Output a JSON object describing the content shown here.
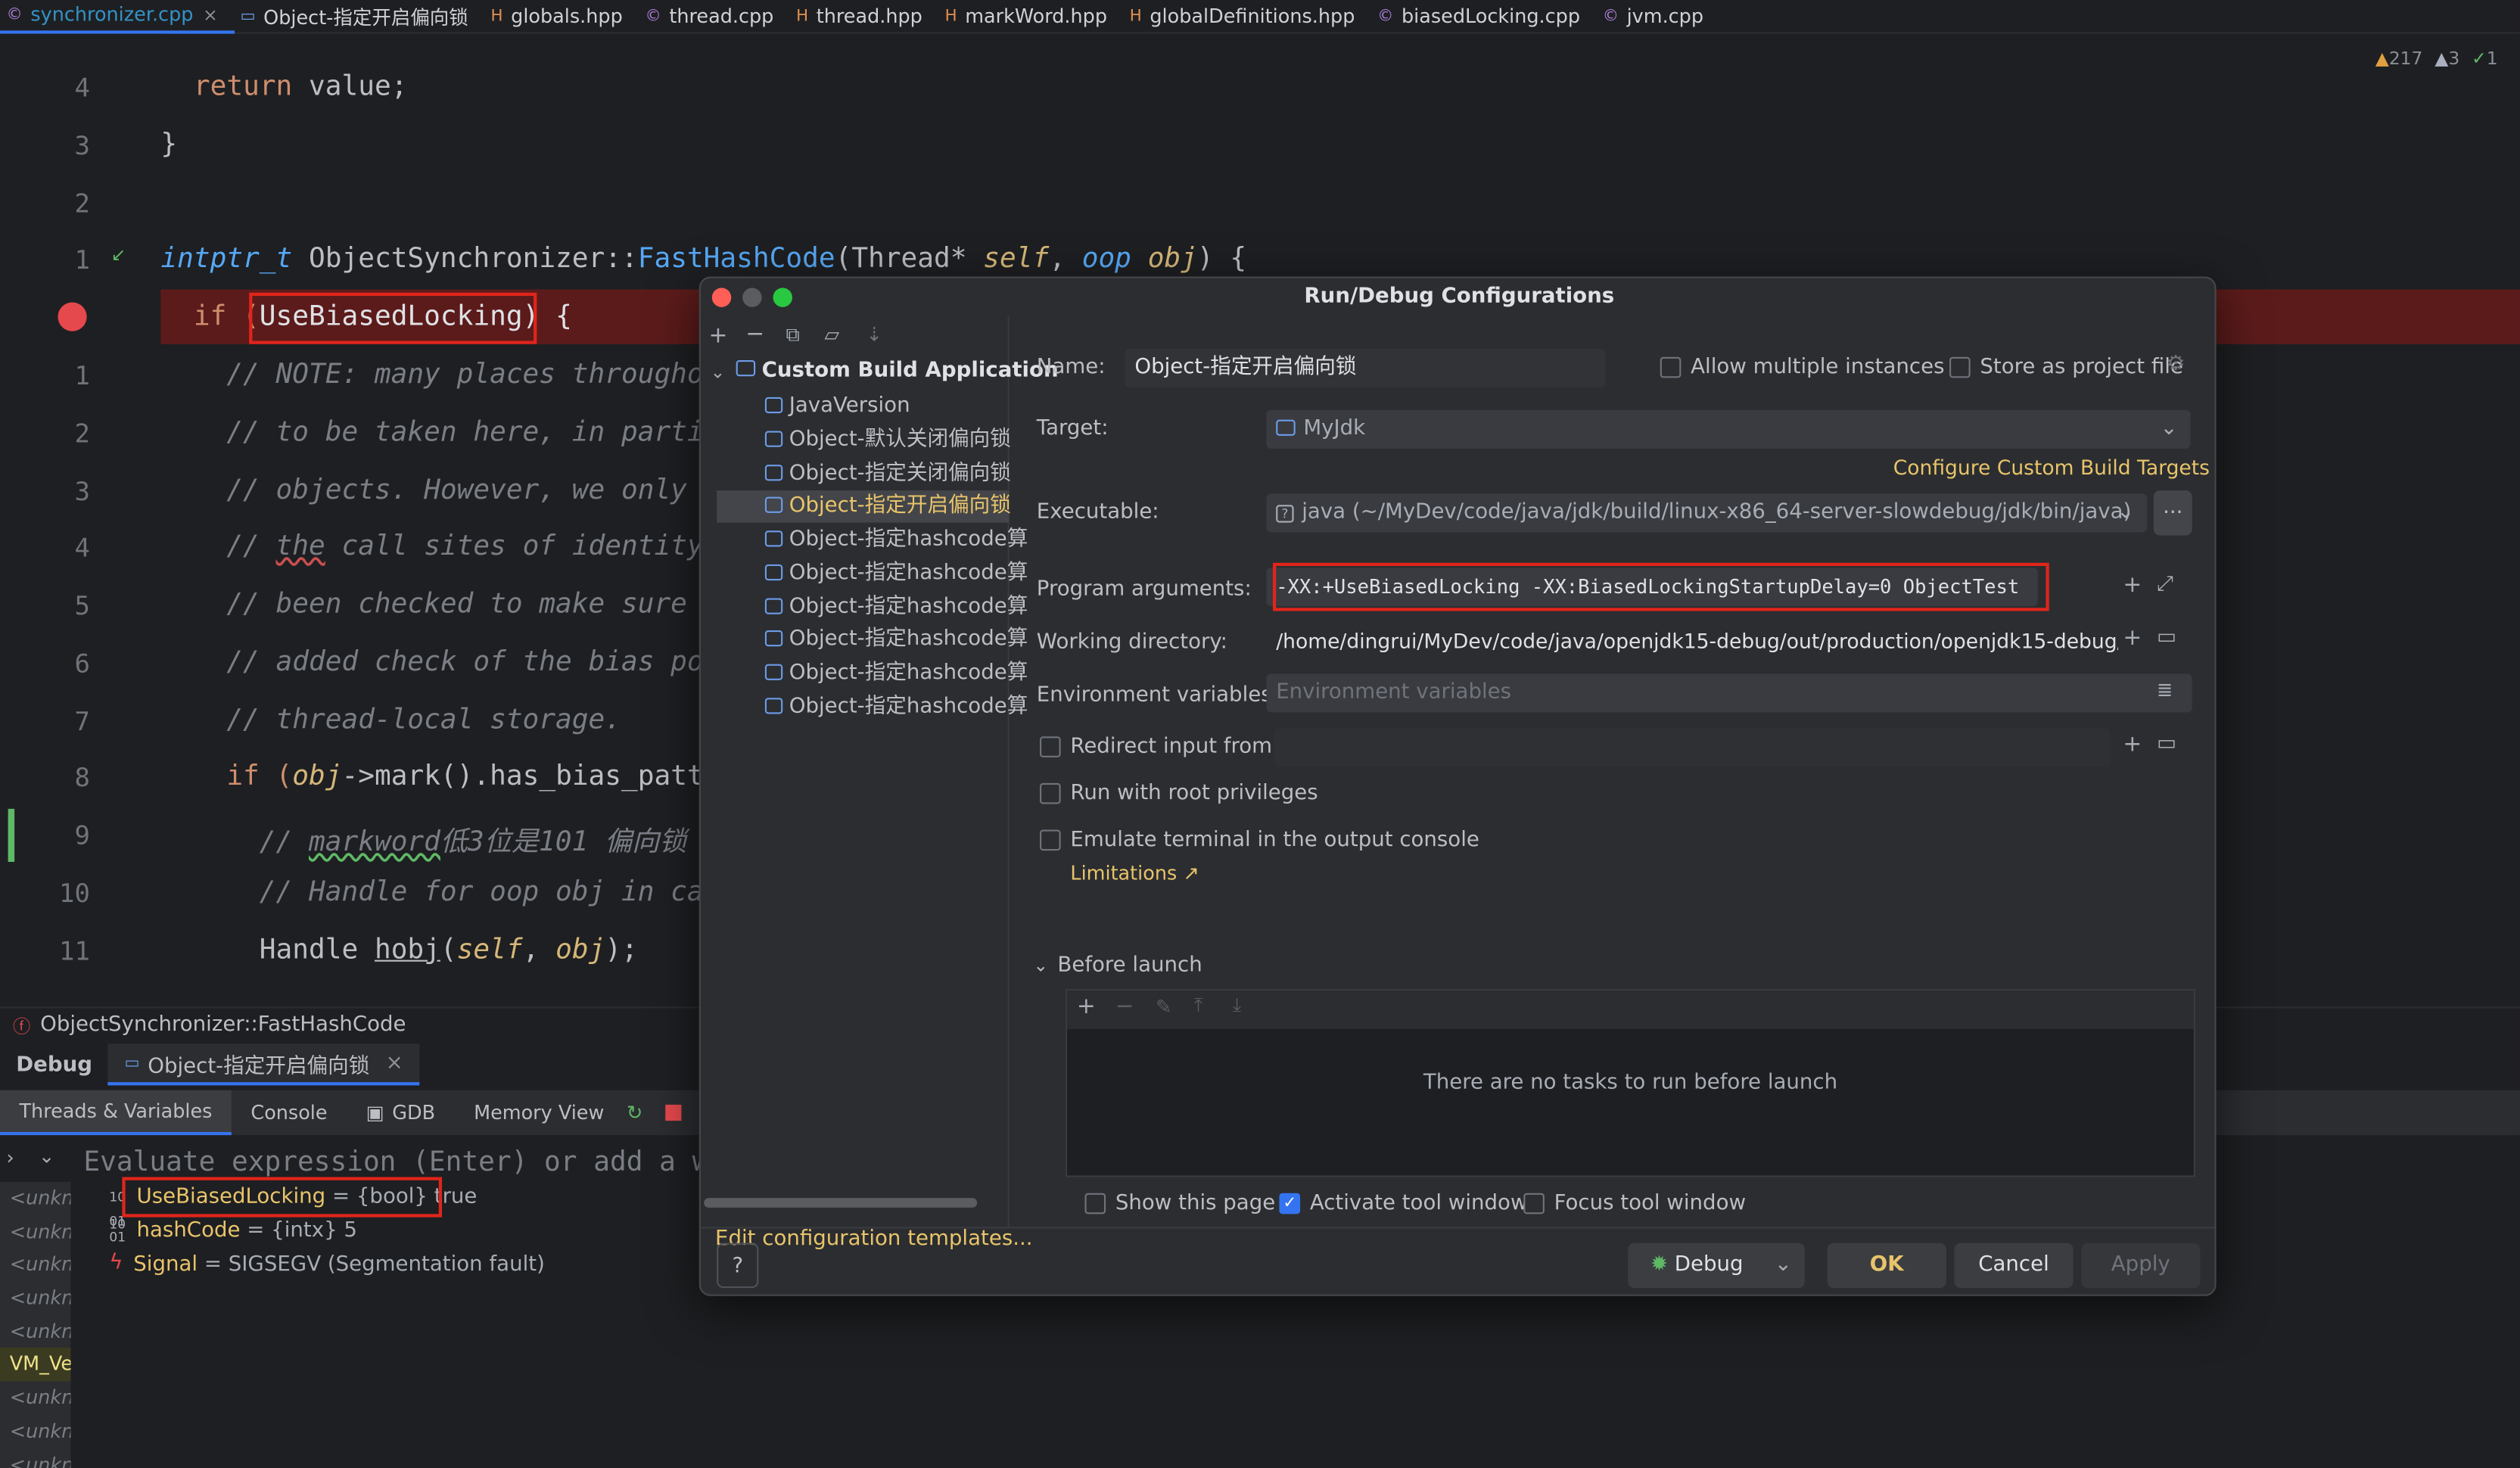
{
  "tabs": [
    {
      "label": "synchronizer.cpp",
      "icon": "c"
    },
    {
      "label": "Object-指定开启偏向锁",
      "icon": "app"
    },
    {
      "label": "globals.hpp",
      "icon": "h"
    },
    {
      "label": "thread.cpp",
      "icon": "c"
    },
    {
      "label": "thread.hpp",
      "icon": "h"
    },
    {
      "label": "markWord.hpp",
      "icon": "h"
    },
    {
      "label": "globalDefinitions.hpp",
      "icon": "h"
    },
    {
      "label": "biasedLocking.cpp",
      "icon": "c"
    },
    {
      "label": "jvm.cpp",
      "icon": "c"
    }
  ],
  "inspections": {
    "warnings": "217",
    "weak": "3",
    "ok": "1"
  },
  "editor": {
    "line_numbers": [
      "4",
      "3",
      "2",
      "1",
      "",
      "1",
      "2",
      "3",
      "4",
      "5",
      "6",
      "7",
      "8",
      "9",
      "10",
      "11"
    ],
    "l0a": "  ",
    "l0b": "return",
    " l0c": " value;",
    "l1": "}",
    "fn_ret": "intptr_t",
    "fn_cls": " ObjectSynchronizer::",
    "fn_name": "FastHashCode",
    "fn_p1": "(Thread* ",
    "fn_self": "self",
    "fn_p2": ", ",
    "fn_oop": "oop",
    "fn_obj": " obj",
    ") {": "",
    "fn_end": ") {",
    "bp_if": "  if (",
    "bp_var": "UseBiasedLocking",
    "bp_end": ") {",
    "c1": "    // NOTE: many places throughout",
    "c2": "    // to be taken here, in parti",
    "c3": "    // objects. However, we only",
    "c4a": "    // ",
    "c4b": "the",
    " c4c": " call sites of identity",
    "c5": "    // been checked to make sure",
    "c6": "    // added check of the bias po",
    "c7": "    // thread-local storage.",
    "l8a": "    if (",
    "l8b": "obj",
    "l8c": "->mark().has_bias_patt",
    "l9a": "      // ",
    "l9b": "markword",
    "l9c": "低3位是101 偏向锁",
    "l10": "      // Handle for oop obj in ca",
    "l11a": "      Handle ",
    "l11b": "hobj",
    "l11c": "(",
    "l11d": "self",
    ", ": "",
    "l11e": "obj",
    "l11f": ");"
  },
  "breadcrumb": "ObjectSynchronizer::FastHashCode",
  "debug": {
    "title": "Debug",
    "session": "Object-指定开启偏向锁"
  },
  "subtabs": [
    "Threads & Variables",
    "Console",
    "GDB",
    "Memory View"
  ],
  "evaluate_placeholder": "Evaluate expression (Enter) or add a w",
  "threads": [
    "<unkn",
    "<unkn",
    "<unkn",
    "<unkn",
    "<unkn",
    "VM_Ve",
    "<unkn",
    "<unkn",
    "<unkn"
  ],
  "variables": [
    {
      "name": "UseBiasedLocking",
      "value": " = {bool} true"
    },
    {
      "name": "hashCode",
      "value": " = {intx} 5"
    },
    {
      "name": "Signal",
      "value": " = SIGSEGV (Segmentation fault)"
    }
  ],
  "dialog": {
    "title": "Run/Debug Configurations",
    "tree_root": "Custom Build Application",
    "tree_items": [
      "JavaVersion",
      "Object-默认关闭偏向锁",
      "Object-指定关闭偏向锁",
      "Object-指定开启偏向锁",
      "Object-指定hashcode算",
      "Object-指定hashcode算",
      "Object-指定hashcode算",
      "Object-指定hashcode算",
      "Object-指定hashcode算",
      "Object-指定hashcode算"
    ],
    "edit_templates": "Edit configuration templates...",
    "name_label": "Name:",
    "name_value": "Object-指定开启偏向锁",
    "allow_multiple": "Allow multiple instances",
    "store_project": "Store as project file",
    "target_label": "Target:",
    "target_value": "MyJdk",
    "configure_targets": "Configure Custom Build Targets",
    "executable_label": "Executable:",
    "executable_value": "java (~/MyDev/code/java/jdk/build/linux-x86_64-server-slowdebug/jdk/bin/java)",
    "args_label": "Program arguments:",
    "args_value": "-XX:+UseBiasedLocking -XX:BiasedLockingStartupDelay=0 ObjectTest",
    "workdir_label": "Working directory:",
    "workdir_value": "/home/dingrui/MyDev/code/java/openjdk15-debug/out/production/openjdk15-debug/",
    "env_label": "Environment variables:",
    "env_placeholder": "Environment variables",
    "redirect": "Redirect input from:",
    "root": "Run with root privileges",
    "emulate": "Emulate terminal in the output console",
    "limitations": "Limitations ↗",
    "before_launch": "Before launch",
    "no_tasks": "There are no tasks to run before launch",
    "show_page": "Show this page",
    "activate": "Activate tool window",
    "focus": "Focus tool window",
    "help": "?",
    "debug_btn": "Debug",
    "ok": "OK",
    "cancel": "Cancel",
    "apply": "Apply"
  },
  "colors": {
    "accent": "#3574f0",
    "link": "#e8c46a",
    "highlight": "#e0251b"
  }
}
